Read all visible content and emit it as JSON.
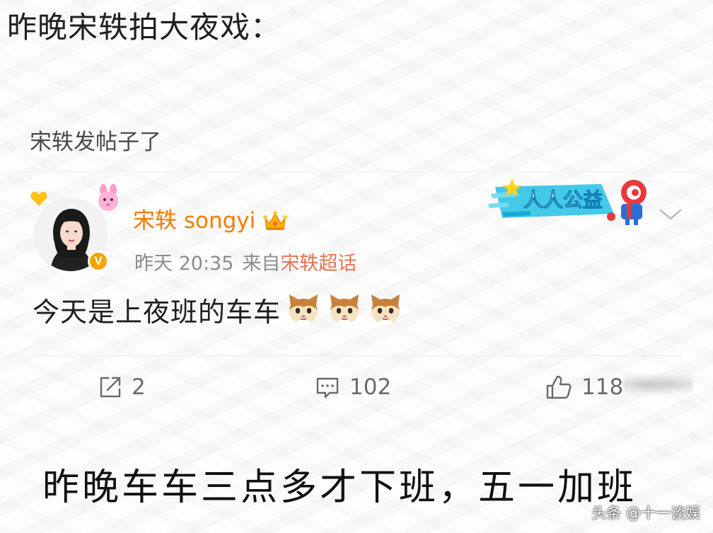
{
  "heading": "昨晚宋轶拍大夜戏：",
  "caption": "宋轶发帖子了",
  "post": {
    "author": {
      "name": "宋轶 songyi",
      "verified_badge": "V",
      "avatar_icon": "avatar-photo-icon",
      "crown_icon": "crown-badge-icon"
    },
    "time": "昨天 20:35",
    "source_prefix": "来自",
    "source": "宋轶超话",
    "promo_banner_text": "人人公益",
    "text": "今天是上夜班的车车",
    "emoji_count": 3,
    "actions": {
      "repost_count": "2",
      "comment_count": "102",
      "like_count": "118"
    }
  },
  "bottom_caption": "昨晚车车三点多才下班，五一加班",
  "watermark": "头条 @十一谈娱",
  "colors": {
    "username": "#f57c00",
    "source_link": "#eb7350",
    "meta_gray": "#8c8c8c",
    "verified": "#f4a300"
  }
}
